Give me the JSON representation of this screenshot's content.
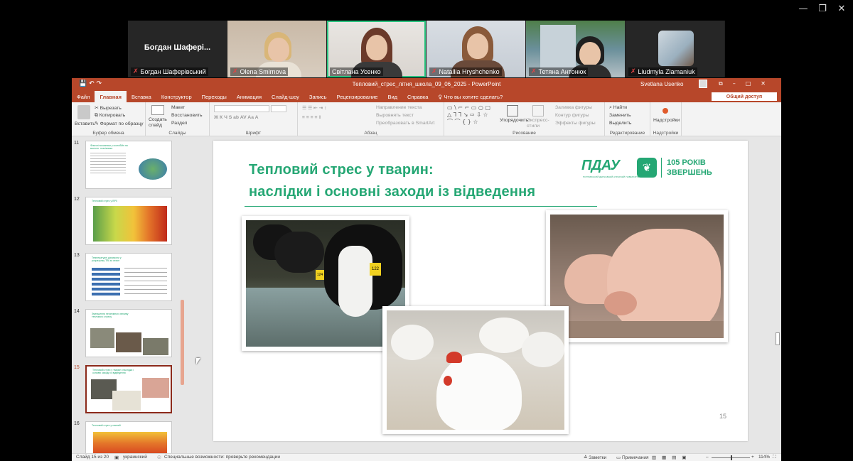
{
  "window_controls": {
    "minimize": "—",
    "restore": "❐",
    "close": "✕"
  },
  "participants": [
    {
      "name": "Богдан Шаферівський",
      "display": "Богдан  Шафері...",
      "muted": true
    },
    {
      "name": "Olena Smirnova",
      "muted": true
    },
    {
      "name": "Світлана Усенко",
      "muted": false,
      "active": true
    },
    {
      "name": "Natallia Hryshchenko",
      "muted": true
    },
    {
      "name": "Тетяна Антонюк",
      "muted": true
    },
    {
      "name": "Liudmyla Zlamaniuk",
      "muted": true
    }
  ],
  "ppt": {
    "title": "Тепловий_стрес_літня_школа_09_06_2025  -  PowerPoint",
    "user": "Svetlana Usenko",
    "share": "Общий доступ",
    "menu": [
      "Файл",
      "Главная",
      "Вставка",
      "Конструктор",
      "Переходы",
      "Анимация",
      "Слайд-шоу",
      "Запись",
      "Рецензирование",
      "Вид",
      "Справка"
    ],
    "search": "Что вы хотите сделать?",
    "ribbon": {
      "paste": "Вставить",
      "cut": "Вырезать",
      "copy": "Копировать",
      "format": "Формат по образцу",
      "clipboard": "Буфер обмена",
      "new_slide": "Создать слайд",
      "layout": "Макет",
      "reset": "Восстановить",
      "section": "Раздел",
      "slides": "Слайды",
      "font": "Шрифт",
      "text_dir": "Направление текста",
      "align_text": "Выровнять текст",
      "smartart": "Преобразовать в SmartArt",
      "paragraph": "Абзац",
      "arrange": "Упорядочить",
      "quick_styles": "Экспресс-стили",
      "fill": "Заливка фигуры",
      "outline": "Контур фигуры",
      "effects": "Эффекты фигуры",
      "drawing": "Рисование",
      "find": "Найти",
      "replace": "Заменить",
      "select": "Выделить",
      "editing": "Редактирование",
      "addins": "Надстройки",
      "addins_group": "Надстройки"
    },
    "thumbnails": [
      {
        "num": "11",
        "title": "Фізичні показники у скотобійн на молочн. птахівника"
      },
      {
        "num": "12",
        "title": "Тепловий стрес у ВРХ"
      },
      {
        "num": "13",
        "title": "Температурні діапазони у розрахунку ТВІ за сезон"
      },
      {
        "num": "14",
        "title": "Зменшення негативного впливу теплового стресу"
      },
      {
        "num": "15",
        "title": "Тепловий стрес у тварин: наслідки і основні заходи із відведення",
        "selected": true
      },
      {
        "num": "16",
        "title": "Тепловий стрес у свиней"
      }
    ],
    "slide": {
      "title_line1": "Тепловий стрес у тварин:",
      "title_line2": "наслідки і основні заходи із відведення",
      "logo_text": "ПДАУ",
      "logo_sub": "ПОЛТАВСЬКИЙ ДЕРЖАВНИЙ АГРАРНИЙ УНІВЕРСИТЕТ",
      "anniv_line1": "105 РОКІВ",
      "anniv_line2": "ЗВЕРШЕНЬ",
      "ear_tags": [
        "122",
        "124"
      ],
      "page_num": "15"
    },
    "status": {
      "slide_info": "Слайд 15 из 20",
      "language": "украинский",
      "accessibility": "Специальные возможности: проверьте рекомендации",
      "notes": "Заметки",
      "comments": "Примечания",
      "zoom": "114%"
    }
  },
  "colors": {
    "accent": "#b7472a",
    "slide_green": "#25a774",
    "active_tile": "#2bc37f"
  }
}
